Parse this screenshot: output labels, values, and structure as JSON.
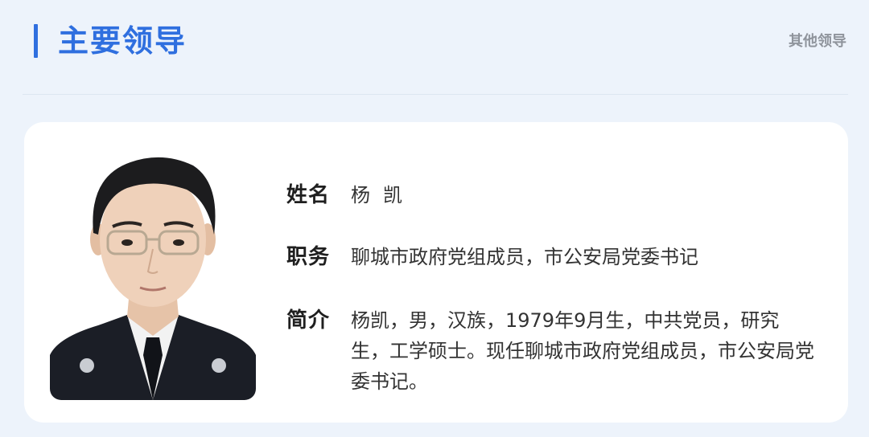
{
  "header": {
    "title": "主要领导",
    "other_link": "其他领导"
  },
  "profile": {
    "photo_alt": "杨凯",
    "name_label": "姓名",
    "name": "杨凯",
    "position_label": "职务",
    "position": "聊城市政府党组成员，市公安局党委书记",
    "bio_label": "简介",
    "bio": "杨凯，男，汉族，1979年9月生，中共党员，研究生，工学硕士。现任聊城市政府党组成员，市公安局党委书记。"
  },
  "colors": {
    "accent": "#2f6fdf",
    "background": "#edf3fb",
    "card": "#ffffff"
  }
}
